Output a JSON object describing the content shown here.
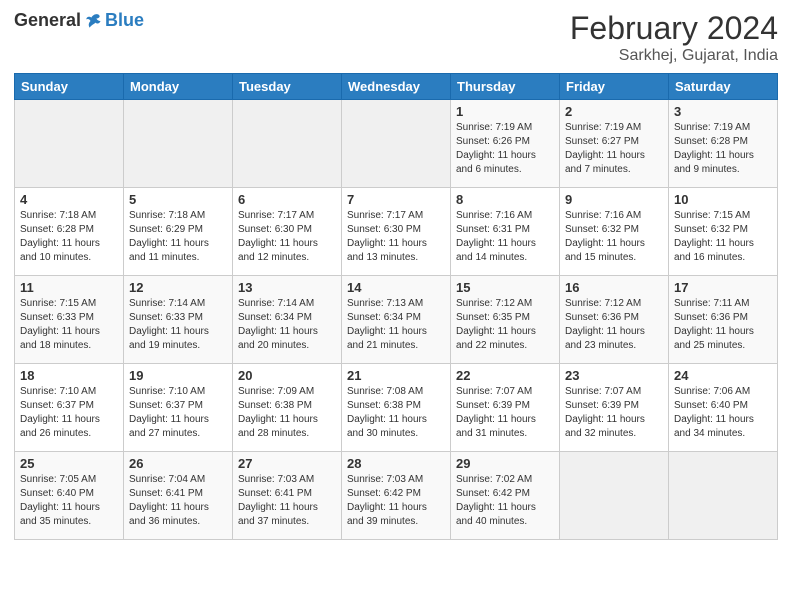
{
  "logo": {
    "general": "General",
    "blue": "Blue"
  },
  "title": "February 2024",
  "subtitle": "Sarkhej, Gujarat, India",
  "days_of_week": [
    "Sunday",
    "Monday",
    "Tuesday",
    "Wednesday",
    "Thursday",
    "Friday",
    "Saturday"
  ],
  "weeks": [
    [
      {
        "day": "",
        "info": ""
      },
      {
        "day": "",
        "info": ""
      },
      {
        "day": "",
        "info": ""
      },
      {
        "day": "",
        "info": ""
      },
      {
        "day": "1",
        "info": "Sunrise: 7:19 AM\nSunset: 6:26 PM\nDaylight: 11 hours and 6 minutes."
      },
      {
        "day": "2",
        "info": "Sunrise: 7:19 AM\nSunset: 6:27 PM\nDaylight: 11 hours and 7 minutes."
      },
      {
        "day": "3",
        "info": "Sunrise: 7:19 AM\nSunset: 6:28 PM\nDaylight: 11 hours and 9 minutes."
      }
    ],
    [
      {
        "day": "4",
        "info": "Sunrise: 7:18 AM\nSunset: 6:28 PM\nDaylight: 11 hours and 10 minutes."
      },
      {
        "day": "5",
        "info": "Sunrise: 7:18 AM\nSunset: 6:29 PM\nDaylight: 11 hours and 11 minutes."
      },
      {
        "day": "6",
        "info": "Sunrise: 7:17 AM\nSunset: 6:30 PM\nDaylight: 11 hours and 12 minutes."
      },
      {
        "day": "7",
        "info": "Sunrise: 7:17 AM\nSunset: 6:30 PM\nDaylight: 11 hours and 13 minutes."
      },
      {
        "day": "8",
        "info": "Sunrise: 7:16 AM\nSunset: 6:31 PM\nDaylight: 11 hours and 14 minutes."
      },
      {
        "day": "9",
        "info": "Sunrise: 7:16 AM\nSunset: 6:32 PM\nDaylight: 11 hours and 15 minutes."
      },
      {
        "day": "10",
        "info": "Sunrise: 7:15 AM\nSunset: 6:32 PM\nDaylight: 11 hours and 16 minutes."
      }
    ],
    [
      {
        "day": "11",
        "info": "Sunrise: 7:15 AM\nSunset: 6:33 PM\nDaylight: 11 hours and 18 minutes."
      },
      {
        "day": "12",
        "info": "Sunrise: 7:14 AM\nSunset: 6:33 PM\nDaylight: 11 hours and 19 minutes."
      },
      {
        "day": "13",
        "info": "Sunrise: 7:14 AM\nSunset: 6:34 PM\nDaylight: 11 hours and 20 minutes."
      },
      {
        "day": "14",
        "info": "Sunrise: 7:13 AM\nSunset: 6:34 PM\nDaylight: 11 hours and 21 minutes."
      },
      {
        "day": "15",
        "info": "Sunrise: 7:12 AM\nSunset: 6:35 PM\nDaylight: 11 hours and 22 minutes."
      },
      {
        "day": "16",
        "info": "Sunrise: 7:12 AM\nSunset: 6:36 PM\nDaylight: 11 hours and 23 minutes."
      },
      {
        "day": "17",
        "info": "Sunrise: 7:11 AM\nSunset: 6:36 PM\nDaylight: 11 hours and 25 minutes."
      }
    ],
    [
      {
        "day": "18",
        "info": "Sunrise: 7:10 AM\nSunset: 6:37 PM\nDaylight: 11 hours and 26 minutes."
      },
      {
        "day": "19",
        "info": "Sunrise: 7:10 AM\nSunset: 6:37 PM\nDaylight: 11 hours and 27 minutes."
      },
      {
        "day": "20",
        "info": "Sunrise: 7:09 AM\nSunset: 6:38 PM\nDaylight: 11 hours and 28 minutes."
      },
      {
        "day": "21",
        "info": "Sunrise: 7:08 AM\nSunset: 6:38 PM\nDaylight: 11 hours and 30 minutes."
      },
      {
        "day": "22",
        "info": "Sunrise: 7:07 AM\nSunset: 6:39 PM\nDaylight: 11 hours and 31 minutes."
      },
      {
        "day": "23",
        "info": "Sunrise: 7:07 AM\nSunset: 6:39 PM\nDaylight: 11 hours and 32 minutes."
      },
      {
        "day": "24",
        "info": "Sunrise: 7:06 AM\nSunset: 6:40 PM\nDaylight: 11 hours and 34 minutes."
      }
    ],
    [
      {
        "day": "25",
        "info": "Sunrise: 7:05 AM\nSunset: 6:40 PM\nDaylight: 11 hours and 35 minutes."
      },
      {
        "day": "26",
        "info": "Sunrise: 7:04 AM\nSunset: 6:41 PM\nDaylight: 11 hours and 36 minutes."
      },
      {
        "day": "27",
        "info": "Sunrise: 7:03 AM\nSunset: 6:41 PM\nDaylight: 11 hours and 37 minutes."
      },
      {
        "day": "28",
        "info": "Sunrise: 7:03 AM\nSunset: 6:42 PM\nDaylight: 11 hours and 39 minutes."
      },
      {
        "day": "29",
        "info": "Sunrise: 7:02 AM\nSunset: 6:42 PM\nDaylight: 11 hours and 40 minutes."
      },
      {
        "day": "",
        "info": ""
      },
      {
        "day": "",
        "info": ""
      }
    ]
  ]
}
